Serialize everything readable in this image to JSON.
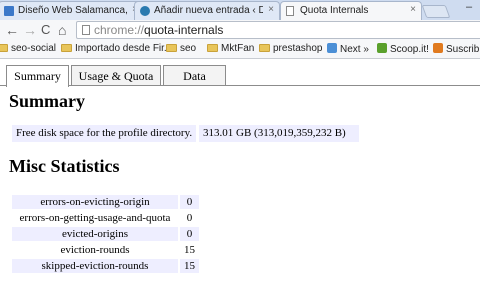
{
  "browser": {
    "tabs": [
      {
        "title": "Diseño Web Salamanca, P"
      },
      {
        "title": "Añadir nueva entrada ‹ Di"
      },
      {
        "title": "Quota Internals"
      }
    ],
    "tab_close": "×",
    "window_minimize": "–",
    "url_scheme": "chrome://",
    "url_path": "quota-internals",
    "nav": {
      "back": "←",
      "forward": "→",
      "reload": "C",
      "home": "⌂"
    },
    "bookmarks": [
      {
        "label": "seo-social"
      },
      {
        "label": "Importado desde Fir..."
      },
      {
        "label": "seo"
      },
      {
        "label": "MktFan"
      },
      {
        "label": "prestashop"
      },
      {
        "label": "Next »"
      },
      {
        "label": "Scoop.it!"
      },
      {
        "label": "Suscribir"
      }
    ]
  },
  "page": {
    "tabs": [
      "Summary",
      "Usage & Quota",
      "Data"
    ],
    "summary_title": "Summary",
    "disk_label": "Free disk space for the profile directory.",
    "disk_value": "313.01 GB (313,019,359,232 B)",
    "misc_title": "Misc Statistics",
    "stats": [
      {
        "key": "errors-on-evicting-origin",
        "value": "0"
      },
      {
        "key": "errors-on-getting-usage-and-quota",
        "value": "0"
      },
      {
        "key": "evicted-origins",
        "value": "0"
      },
      {
        "key": "eviction-rounds",
        "value": "15"
      },
      {
        "key": "skipped-eviction-rounds",
        "value": "15"
      }
    ]
  },
  "colors": {
    "cell_bg": "#eeeeff",
    "tabstrip": "#cfdcf0"
  }
}
